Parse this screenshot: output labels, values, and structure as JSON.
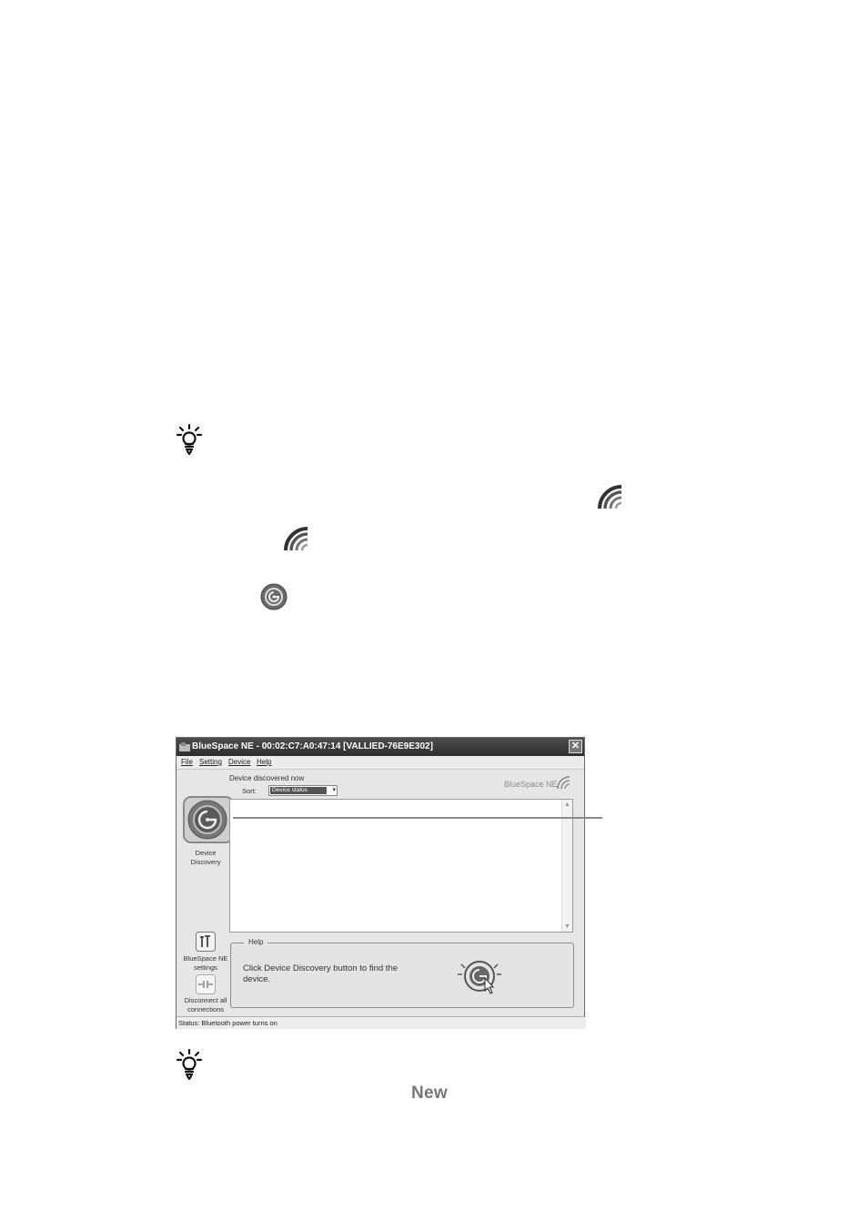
{
  "icons": {
    "tip": "lightbulb-tip-icon",
    "bluespace": "bluespace-ne-icon",
    "discovery": "device-discovery-icon"
  },
  "window": {
    "title": "BlueSpace NE - 00:02:C7:A0:47:14 [VALLIED-76E9E302]",
    "close": "✕",
    "menu": [
      "File",
      "Setting",
      "Device",
      "Help"
    ],
    "header": "Device discovered now",
    "sort_label": "Sort:",
    "sort_value": "Device status",
    "brand": "BlueSpace NE",
    "sidebar": {
      "discovery_label_1": "Device",
      "discovery_label_2": "Discovery",
      "settings_label_1": "BlueSpace NE",
      "settings_label_2": "settings",
      "disconnect_label_1": "Disconnect all",
      "disconnect_label_2": "connections"
    },
    "help": {
      "legend": "Help",
      "text": "Click Device Discovery button to find the device."
    },
    "status": "Status: Bluetooth power turns on"
  },
  "new_label": "New",
  "colors": {
    "titlebar": "#3c3c3c",
    "window_bg": "#e6e6e6",
    "callout": "#8a8a8a"
  }
}
